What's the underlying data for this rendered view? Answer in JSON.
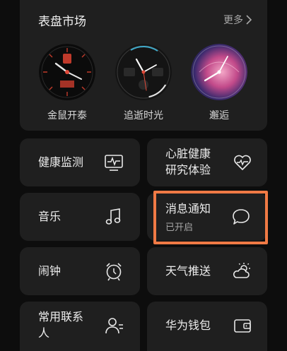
{
  "market": {
    "title": "表盘市场",
    "more_label": "更多",
    "faces": [
      {
        "name": "金鼠开泰",
        "top_number": "7645",
        "date": "2月4日",
        "weekday": "周二"
      },
      {
        "name": "追逝时光",
        "app_label": "Calories",
        "steps_label": "Steps",
        "step_value": "7645",
        "date": "FRI 18",
        "temp": "24°C",
        "time": "10:08"
      },
      {
        "name": "邂逅",
        "top_number": "7645"
      }
    ]
  },
  "tiles": {
    "health_monitor": "健康监测",
    "heart_health": "心脏健康",
    "heart_health_2": "研究体验",
    "music": "音乐",
    "notifications": "消息通知",
    "notifications_status": "已开启",
    "alarm": "闹钟",
    "weather": "天气推送",
    "contacts_1": "常用联系",
    "contacts_2": "人",
    "wallet": "华为钱包"
  },
  "colors": {
    "accent_highlight": "#f07a45",
    "card_bg": "#1f1f1f",
    "page_bg": "#0d0d0d"
  }
}
